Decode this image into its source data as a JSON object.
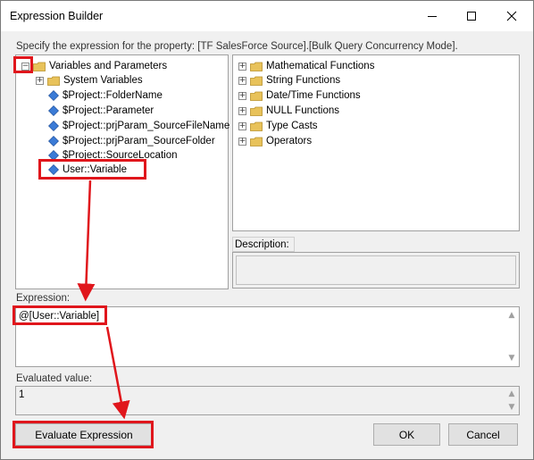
{
  "window": {
    "title": "Expression Builder",
    "minimize_icon": "minimize-icon",
    "maximize_icon": "maximize-icon",
    "close_icon": "close-icon"
  },
  "prompt": "Specify the expression for the property: [TF SalesForce Source].[Bulk Query Concurrency Mode].",
  "variables_tree": {
    "root": "Variables and Parameters",
    "root_expander": "−",
    "children": [
      {
        "label": "System Variables",
        "type": "folder",
        "expander": "+"
      },
      {
        "label": "$Project::FolderName",
        "type": "variable"
      },
      {
        "label": "$Project::Parameter",
        "type": "variable"
      },
      {
        "label": "$Project::prjParam_SourceFileName",
        "type": "variable"
      },
      {
        "label": "$Project::prjParam_SourceFolder",
        "type": "variable"
      },
      {
        "label": "$Project::SourceLocation",
        "type": "variable"
      },
      {
        "label": "User::Variable",
        "type": "variable"
      }
    ]
  },
  "functions_tree": [
    {
      "label": "Mathematical Functions",
      "expander": "+"
    },
    {
      "label": "String Functions",
      "expander": "+"
    },
    {
      "label": "Date/Time Functions",
      "expander": "+"
    },
    {
      "label": "NULL Functions",
      "expander": "+"
    },
    {
      "label": "Type Casts",
      "expander": "+"
    },
    {
      "label": "Operators",
      "expander": "+"
    }
  ],
  "description": {
    "label": "Description:",
    "value": ""
  },
  "expression": {
    "label": "Expression:",
    "value": "@[User::Variable]"
  },
  "evaluated": {
    "label": "Evaluated value:",
    "value": "1"
  },
  "buttons": {
    "evaluate": "Evaluate Expression",
    "ok": "OK",
    "cancel": "Cancel"
  },
  "colors": {
    "highlight": "#e0161c",
    "folder": "#e8c25a",
    "variable_icon": "#3b7bd6"
  }
}
